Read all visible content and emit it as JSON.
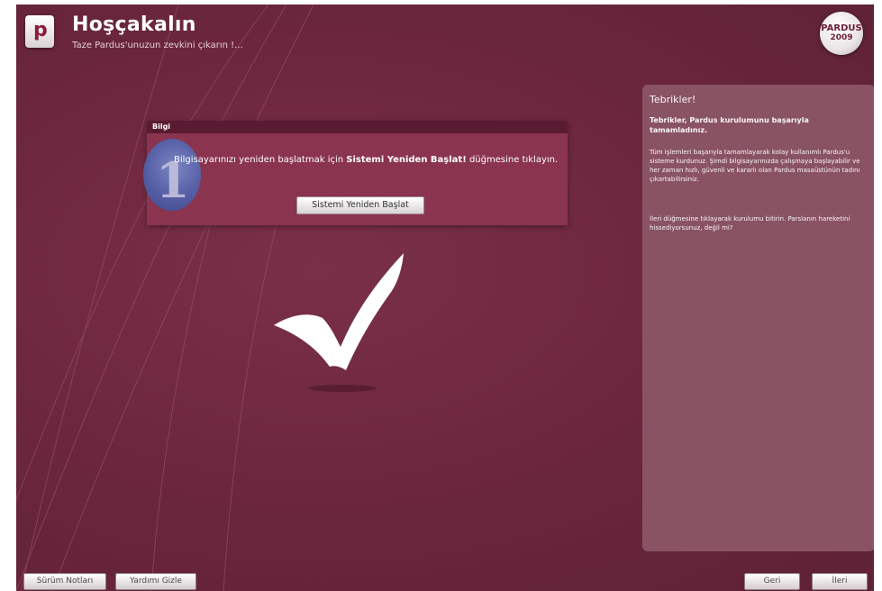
{
  "header": {
    "logo_letter": "p",
    "title": "Hoşçakalın",
    "subtitle": "Taze Pardus'unuzun zevkini çıkarın !...",
    "badge_line1": "PARDUS",
    "badge_line2": "2009"
  },
  "info_dialog": {
    "header": "Bilgi",
    "icon_glyph": "1",
    "text_before": "Bilgisayarınızı yeniden başlatmak için ",
    "text_bold": "Sistemi Yeniden Başlat!",
    "text_after": " düğmesine tıklayın.",
    "restart_button": "Sistemi Yeniden Başlat"
  },
  "help_panel": {
    "title": "Tebrikler!",
    "lead": "Tebrikler, Pardus kurulumunu başarıyla tamamladınız.",
    "paragraph1": "Tüm işlemleri başarıyla tamamlayarak kolay kullanımlı Pardus'u sisteme kurdunuz. Şimdi bilgisayarınızda çalışmaya başlayabilir ve her zaman hızlı, güvenli ve kararlı olan Pardus masaüstünün tadını çıkartabilirsiniz.",
    "paragraph2": "İleri düğmesine tıklayarak kurulumu bitirin. Parslanın hareketini hissediyorsunuz, değil mi?"
  },
  "footer": {
    "release_notes": "Sürüm Notları",
    "hide_help": "Yardımı Gizle",
    "back": "Geri",
    "next": "İleri"
  },
  "colors": {
    "background": "#6d2a40",
    "dialog": "#8a3450",
    "dialog_header": "#5a1b32",
    "help_panel": "#8b5566"
  }
}
